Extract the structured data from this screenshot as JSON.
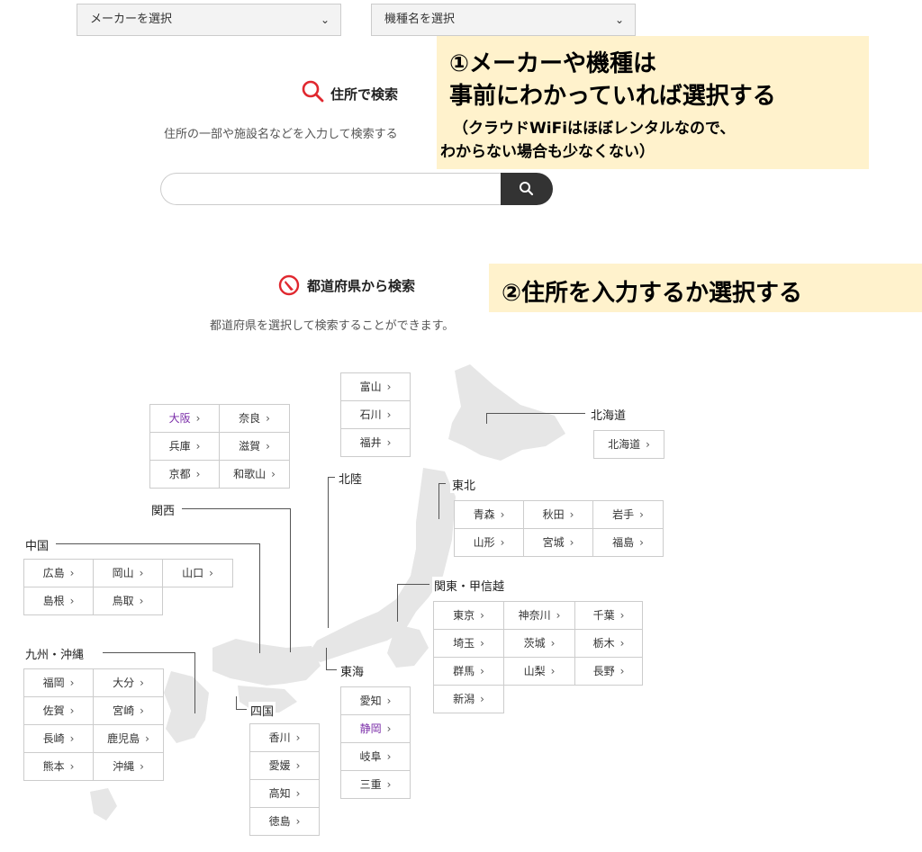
{
  "selects": {
    "maker": {
      "label": "メーカーを選択"
    },
    "model": {
      "label": "機種名を選択"
    }
  },
  "address_search": {
    "title": "住所で検索",
    "description": "住所の一部や施設名などを入力して検索する",
    "placeholder": ""
  },
  "prefecture_search": {
    "title": "都道府県から検索",
    "description": "都道府県を選択して検索することができます。"
  },
  "annotations": {
    "callout1": {
      "line1": "①メーカーや機種は",
      "line2": "事前にわかっていれば選択する",
      "line3": "（クラウドWiFiはほぼレンタルなので、",
      "line4": "わからない場合も少なくない）"
    },
    "callout2": {
      "text": "②住所を入力するか選択する"
    }
  },
  "arrow": "›",
  "regions": {
    "hokkaido": {
      "label": "北海道",
      "prefs": [
        {
          "name": "北海道"
        }
      ]
    },
    "tohoku": {
      "label": "東北",
      "prefs": [
        {
          "name": "青森"
        },
        {
          "name": "秋田"
        },
        {
          "name": "岩手"
        },
        {
          "name": "山形"
        },
        {
          "name": "宮城"
        },
        {
          "name": "福島"
        }
      ]
    },
    "hokuriku": {
      "label": "北陸",
      "prefs": [
        {
          "name": "富山"
        },
        {
          "name": "石川"
        },
        {
          "name": "福井"
        }
      ]
    },
    "kanto": {
      "label": "関東・甲信越",
      "prefs": [
        {
          "name": "東京"
        },
        {
          "name": "神奈川"
        },
        {
          "name": "千葉"
        },
        {
          "name": "埼玉"
        },
        {
          "name": "茨城"
        },
        {
          "name": "栃木"
        },
        {
          "name": "群馬"
        },
        {
          "name": "山梨"
        },
        {
          "name": "長野"
        },
        {
          "name": "新潟"
        }
      ]
    },
    "kansai": {
      "label": "関西",
      "prefs": [
        {
          "name": "大阪",
          "visited": true
        },
        {
          "name": "奈良"
        },
        {
          "name": "兵庫"
        },
        {
          "name": "滋賀"
        },
        {
          "name": "京都"
        },
        {
          "name": "和歌山"
        }
      ]
    },
    "chugoku": {
      "label": "中国",
      "prefs": [
        {
          "name": "広島"
        },
        {
          "name": "岡山"
        },
        {
          "name": "山口"
        },
        {
          "name": "島根"
        },
        {
          "name": "鳥取"
        }
      ]
    },
    "kyushu": {
      "label": "九州・沖縄",
      "prefs": [
        {
          "name": "福岡"
        },
        {
          "name": "大分"
        },
        {
          "name": "佐賀"
        },
        {
          "name": "宮崎"
        },
        {
          "name": "長崎"
        },
        {
          "name": "鹿児島"
        },
        {
          "name": "熊本"
        },
        {
          "name": "沖縄"
        }
      ]
    },
    "tokai": {
      "label": "東海",
      "prefs": [
        {
          "name": "愛知"
        },
        {
          "name": "静岡",
          "visited": true
        },
        {
          "name": "岐阜"
        },
        {
          "name": "三重"
        }
      ]
    },
    "shikoku": {
      "label": "四国",
      "prefs": [
        {
          "name": "香川"
        },
        {
          "name": "愛媛"
        },
        {
          "name": "高知"
        },
        {
          "name": "徳島"
        }
      ]
    }
  }
}
